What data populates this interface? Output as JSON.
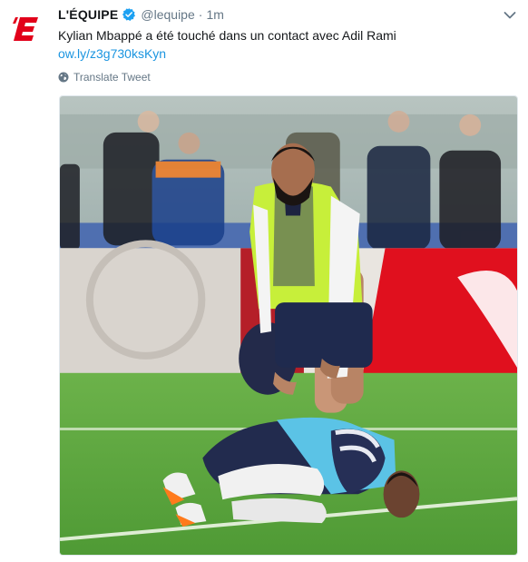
{
  "tweet": {
    "avatar_icon": "lequipe-logo-icon",
    "display_name": "L'ÉQUIPE",
    "verified_icon": "verified-badge-icon",
    "handle": "@lequipe",
    "separator": "·",
    "timestamp": "1m",
    "more_icon": "chevron-down-icon",
    "text": "Kylian Mbappé a été touché dans un contact avec Adil Rami",
    "link": "ow.ly/z3g730ksKyn",
    "translate_icon": "globe-icon",
    "translate_label": "Translate Tweet",
    "media_image": "football-training-photo",
    "colors": {
      "link": "#1b95e0",
      "secondary_text": "#657786",
      "brand_red": "#e2001a",
      "verified_blue": "#1da1f2"
    }
  }
}
